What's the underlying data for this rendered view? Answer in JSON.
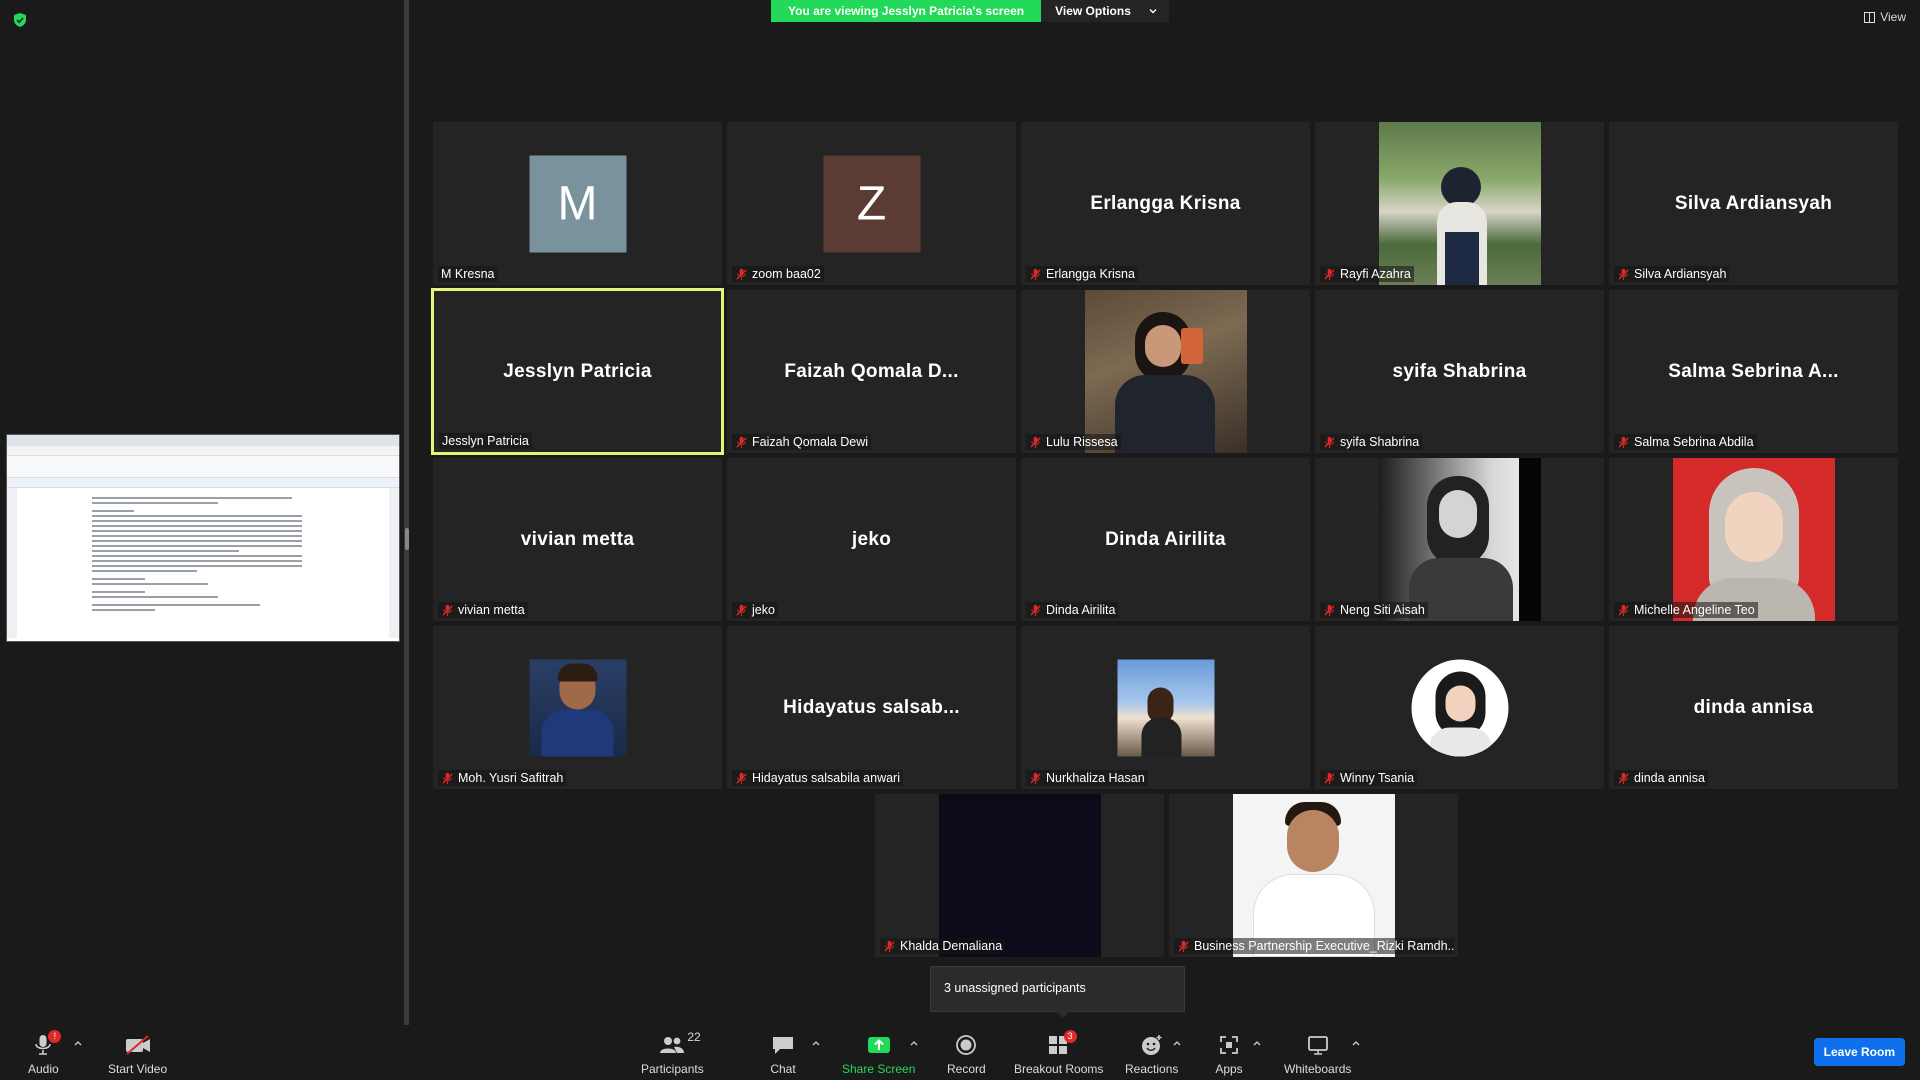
{
  "share_banner": {
    "text": "You are viewing Jesslyn Patricia's screen",
    "view_options_label": "View Options"
  },
  "view_button_label": "View",
  "tiles": [
    {
      "name": "M Kresna",
      "display": "avatar",
      "avatar_letter": "M",
      "avatar_color": "#7a929c",
      "muted": false
    },
    {
      "name": "zoom baa02",
      "display": "avatar",
      "avatar_letter": "Z",
      "avatar_color": "#5a3c34",
      "muted": true
    },
    {
      "name": "Erlangga Krisna",
      "display": "name",
      "big_name": "Erlangga Krisna",
      "muted": true
    },
    {
      "name": "Rayfi Azahra",
      "display": "photo",
      "muted": true
    },
    {
      "name": "Silva Ardiansyah",
      "display": "name",
      "big_name": "Silva Ardiansyah",
      "muted": true
    },
    {
      "name": "Jesslyn Patricia",
      "display": "name",
      "big_name": "Jesslyn Patricia",
      "muted": false,
      "active": true
    },
    {
      "name": "Faizah Qomala Dewi",
      "display": "name",
      "big_name": "Faizah Qomala D...",
      "muted": true
    },
    {
      "name": "Lulu Rissesa",
      "display": "photo",
      "muted": true
    },
    {
      "name": "syifa Shabrina",
      "display": "name",
      "big_name": "syifa Shabrina",
      "muted": true
    },
    {
      "name": "Salma Sebrina Abdila",
      "display": "name",
      "big_name": "Salma Sebrina A...",
      "muted": true
    },
    {
      "name": "vivian metta",
      "display": "name",
      "big_name": "vivian metta",
      "muted": true
    },
    {
      "name": "jeko",
      "display": "name",
      "big_name": "jeko",
      "muted": true
    },
    {
      "name": "Dinda Airilita",
      "display": "name",
      "big_name": "Dinda Airilita",
      "muted": true
    },
    {
      "name": "Neng Siti Aisah",
      "display": "photo",
      "muted": true
    },
    {
      "name": "Michelle Angeline Teo",
      "display": "photo",
      "muted": true
    },
    {
      "name": "Moh. Yusri Safitrah",
      "display": "photo",
      "muted": true
    },
    {
      "name": "Hidayatus salsabila anwari",
      "display": "name",
      "big_name": "Hidayatus salsab...",
      "muted": true
    },
    {
      "name": "Nurkhaliza Hasan",
      "display": "photo",
      "muted": true
    },
    {
      "name": "Winny Tsania",
      "display": "photo",
      "muted": true
    },
    {
      "name": "dinda annisa",
      "display": "name",
      "big_name": "dinda annisa",
      "muted": true
    },
    {
      "name": "Khalda Demaliana",
      "display": "photo",
      "muted": true
    },
    {
      "name": "Business Partnership Executive_Rizki Ramdh...",
      "display": "photo",
      "muted": true
    }
  ],
  "tooltip": "3 unassigned participants",
  "toolbar": {
    "audio": "Audio",
    "audio_badge": "!",
    "start_video": "Start Video",
    "participants": "Participants",
    "participants_count": "22",
    "chat": "Chat",
    "share_screen": "Share Screen",
    "record": "Record",
    "breakout_rooms": "Breakout Rooms",
    "breakout_badge": "3",
    "reactions": "Reactions",
    "apps": "Apps",
    "whiteboards": "Whiteboards",
    "leave_room": "Leave Room"
  },
  "colors": {
    "accent_green": "#23d959",
    "leave_blue": "#0e71eb",
    "active_border": "#e6f27a",
    "mute_red": "#e02828"
  }
}
